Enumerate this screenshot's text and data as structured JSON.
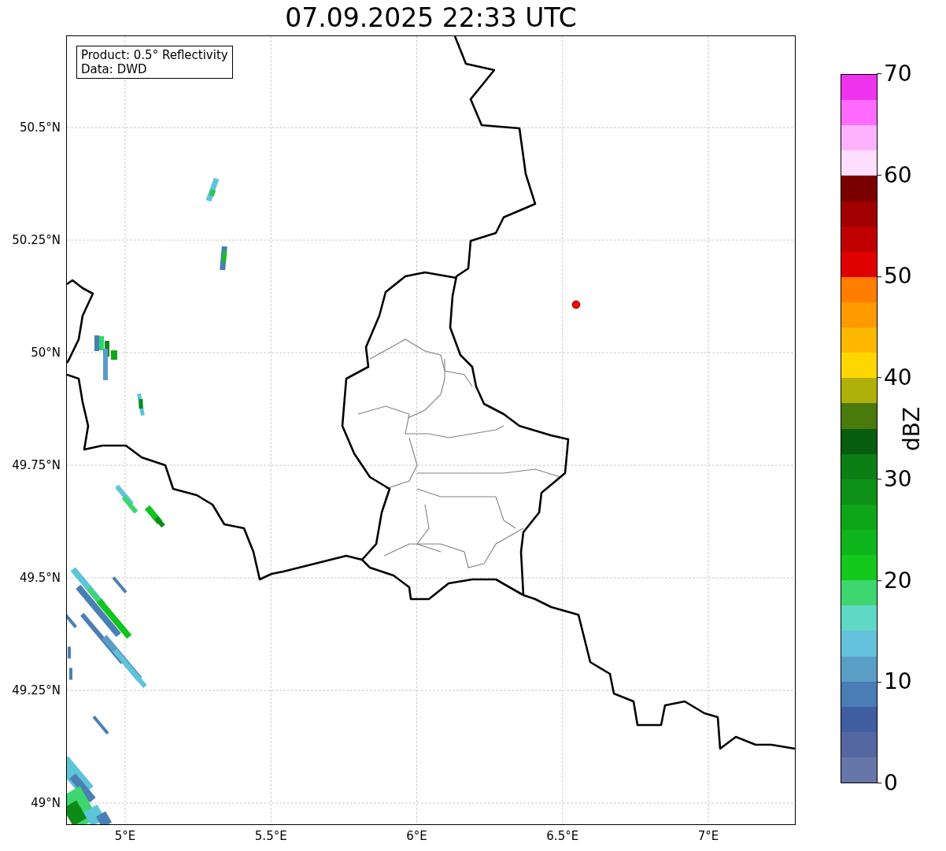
{
  "title": "07.09.2025 22:33 UTC",
  "info_box": [
    "Product: 0.5° Reflectivity",
    "Data: DWD"
  ],
  "map": {
    "xticks": [
      "5°E",
      "5.5°E",
      "6°E",
      "6.5°E",
      "7°E"
    ],
    "yticks": [
      "50.5°N",
      "50.25°N",
      "50°N",
      "49.75°N",
      "49.5°N",
      "49.25°N",
      "49°N"
    ]
  },
  "colorbar": {
    "label": "dBZ",
    "ticks": [
      "70",
      "60",
      "50",
      "40",
      "30",
      "20",
      "10",
      "0"
    ],
    "steps": [
      {
        "color": "#ee33ee"
      },
      {
        "color": "#ff6bff"
      },
      {
        "color": "#ffb3ff"
      },
      {
        "color": "#ffdfff"
      },
      {
        "color": "#7a0000"
      },
      {
        "color": "#a00000"
      },
      {
        "color": "#c00000"
      },
      {
        "color": "#e00000"
      },
      {
        "color": "#ff7e00"
      },
      {
        "color": "#ff9a00"
      },
      {
        "color": "#ffb800"
      },
      {
        "color": "#ffd700"
      },
      {
        "color": "#b0b00a"
      },
      {
        "color": "#4a7a0c"
      },
      {
        "color": "#075c0e"
      },
      {
        "color": "#0b7f14"
      },
      {
        "color": "#0d9217"
      },
      {
        "color": "#0ea618"
      },
      {
        "color": "#0fb51c"
      },
      {
        "color": "#12c91c"
      },
      {
        "color": "#3ed66f"
      },
      {
        "color": "#60d8c6"
      },
      {
        "color": "#64c2dc"
      },
      {
        "color": "#5a9ec6"
      },
      {
        "color": "#4a7cb5"
      },
      {
        "color": "#425ea3"
      },
      {
        "color": "#5467a1"
      },
      {
        "color": "#6676a8"
      }
    ]
  }
}
